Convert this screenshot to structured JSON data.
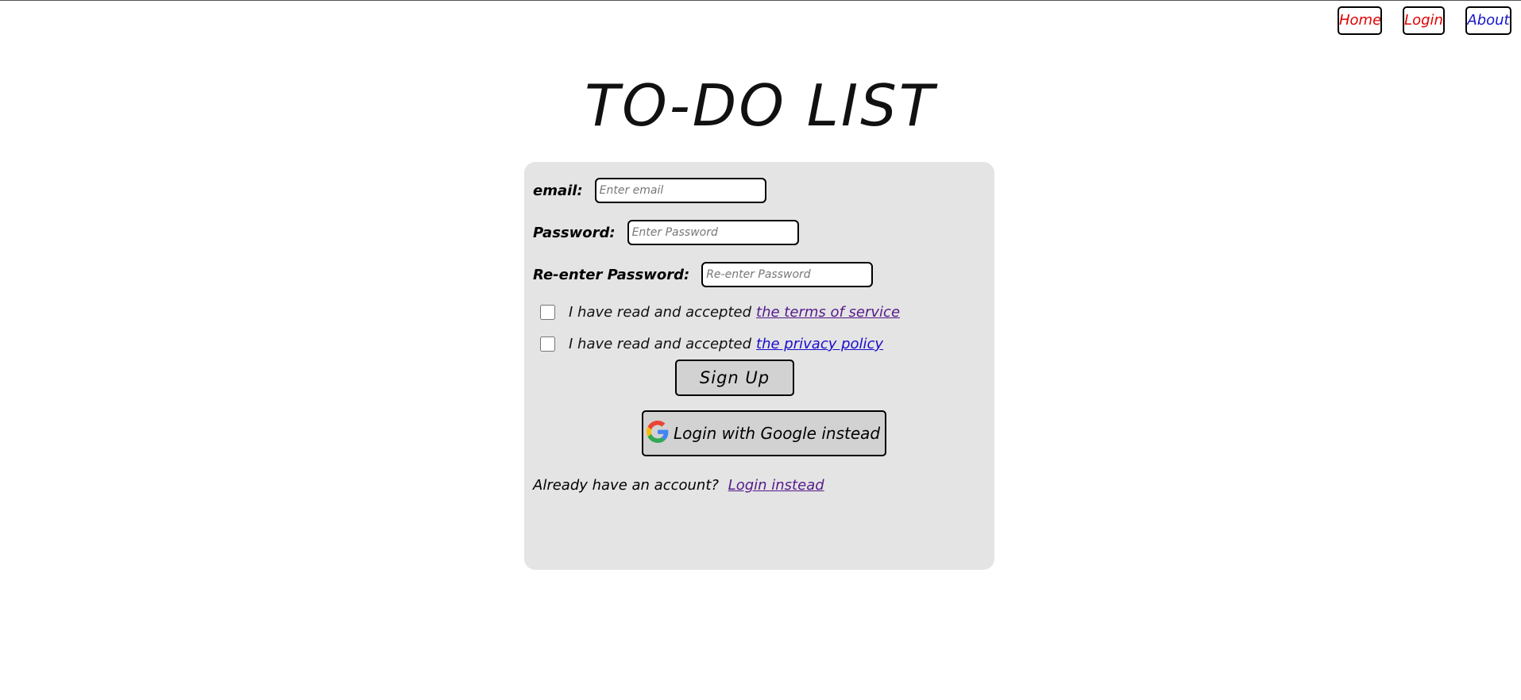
{
  "nav": {
    "home": "Home",
    "login": "Login",
    "about": "About"
  },
  "page_title": "TO-DO LIST",
  "form": {
    "email_label": "email:",
    "email_placeholder": "Enter email",
    "email_value": "",
    "password_label": "Password:",
    "password_placeholder": "Enter Password",
    "password_value": "",
    "repassword_label": "Re-enter Password:",
    "repassword_placeholder": "Re-enter Password",
    "repassword_value": "",
    "tos_text": "I have read and accepted",
    "tos_link": "the terms of service",
    "tos_checked": false,
    "privacy_text": "I have read and accepted",
    "privacy_link": "the privacy policy",
    "privacy_checked": false,
    "signup_label": "Sign Up",
    "google_label": "Login with Google instead",
    "already_text": "Already have an account?",
    "login_instead_link": "Login instead"
  },
  "colors": {
    "card_bg": "#e4e4e4",
    "nav_home": "#e00000",
    "nav_login": "#e00000",
    "nav_about": "#1515c9",
    "button_bg": "#d2d2d2",
    "link_visited": "#551a8b",
    "link_blue": "#1a0dcc"
  },
  "icons": {
    "google": "google-g-icon"
  }
}
